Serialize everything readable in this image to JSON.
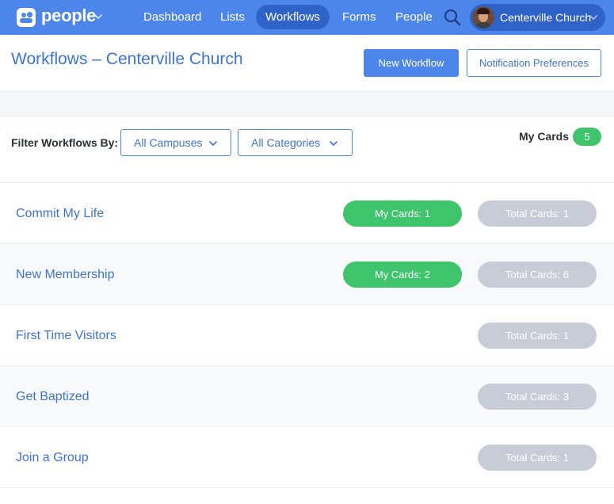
{
  "nav": {
    "app_name": "people",
    "items": [
      {
        "label": "Dashboard",
        "active": false
      },
      {
        "label": "Lists",
        "active": false
      },
      {
        "label": "Workflows",
        "active": true
      },
      {
        "label": "Forms",
        "active": false
      },
      {
        "label": "People",
        "active": false
      }
    ],
    "account_name": "Centerville Church",
    "icons": {
      "logo": "people-logo-icon",
      "search": "search-icon",
      "dropdown": "chevron-down-icon"
    }
  },
  "header": {
    "title": "Workflows – Centerville Church",
    "new_workflow_label": "New Workflow",
    "notification_label": "Notification Preferences"
  },
  "filters": {
    "label": "Filter Workflows By:",
    "campus_value": "All Campuses",
    "category_value": "All Categories",
    "my_cards_label": "My Cards",
    "my_cards_count": "5"
  },
  "workflows": [
    {
      "name": "Commit My Life",
      "my_cards": "My Cards: 1",
      "total_cards": "Total Cards: 1"
    },
    {
      "name": "New Membership",
      "my_cards": "My Cards: 2",
      "total_cards": "Total Cards: 6"
    },
    {
      "name": "First Time Visitors",
      "my_cards": null,
      "total_cards": "Total Cards: 1"
    },
    {
      "name": "Get Baptized",
      "my_cards": null,
      "total_cards": "Total Cards: 3"
    },
    {
      "name": "Join a Group",
      "my_cards": null,
      "total_cards": "Total Cards: 1"
    }
  ],
  "colors": {
    "brand_blue": "#4d86ea",
    "active_nav": "#2f63c9",
    "link_blue": "#3d73d8",
    "green": "#3ec46a",
    "gray_pill": "#c8ccd6"
  }
}
